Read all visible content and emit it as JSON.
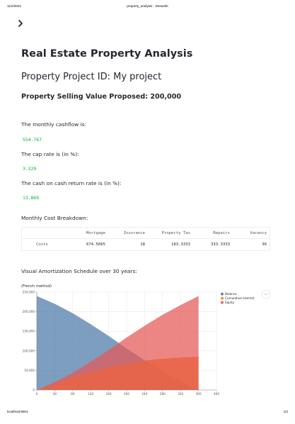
{
  "print_header": {
    "date": "11/2/2021",
    "title": "property_analysis · Streamlit"
  },
  "print_footer": {
    "url": "localhost:8501",
    "page": "1/2"
  },
  "sidebar_toggle": {
    "icon": "chevron-right-icon"
  },
  "page": {
    "title": "Real Estate Property Analysis",
    "project_heading": "Property Project ID: My project",
    "selling_value_heading": "Property Selling Value Proposed: 200,000"
  },
  "metrics": {
    "cashflow_label": "The monthly cashflow is:",
    "cashflow_value": "554.767",
    "cap_rate_label": "The cap rate is (in %):",
    "cap_rate_value": "3.329",
    "coc_label": "The cash on cash return rate is (in %):",
    "coc_value": "13.869"
  },
  "cost_breakdown": {
    "label": "Monthly Cost Breakdown:",
    "columns": [
      "Mortgage",
      "Insurance",
      "Property Tax",
      "Repairs",
      "Vacancy"
    ],
    "row_label": "Costs",
    "values": [
      "674.5665",
      "18",
      "183.3333",
      "333.3333",
      "36"
    ]
  },
  "amortization": {
    "label": "Visual Amortization Schedule over 30 years:"
  },
  "colors": {
    "balance": "#4c78a8",
    "cumulative_interest": "#f58518",
    "equity": "#e45756",
    "code_text": "#09ab3b"
  },
  "chart_data": {
    "type": "area",
    "title": "(French method)",
    "xlabel": "",
    "ylabel": "",
    "xlim": [
      0,
      400
    ],
    "ylim": [
      0,
      250000
    ],
    "x_ticks": [
      "0",
      "40",
      "80",
      "120",
      "160",
      "200",
      "240",
      "280",
      "320",
      "360",
      "400"
    ],
    "y_ticks": [
      "0",
      "50,000",
      "100,000",
      "150,000",
      "200,000",
      "250,000"
    ],
    "x": [
      0,
      40,
      80,
      120,
      160,
      200,
      240,
      280,
      320,
      360
    ],
    "series": [
      {
        "name": "Balance",
        "values": [
          240000,
          220000,
          196000,
          168000,
          138000,
          106000,
          76000,
          48000,
          23000,
          0
        ]
      },
      {
        "name": "Cumulative Interest",
        "values": [
          0,
          16000,
          32000,
          46000,
          58000,
          68000,
          75000,
          80000,
          83000,
          85000
        ]
      },
      {
        "name": "Equity",
        "values": [
          0,
          20000,
          44000,
          72000,
          102000,
          134000,
          164000,
          192000,
          217000,
          240000
        ]
      }
    ],
    "legend_position": "right",
    "grid": true,
    "menu_icon": "more-horizontal-icon"
  }
}
